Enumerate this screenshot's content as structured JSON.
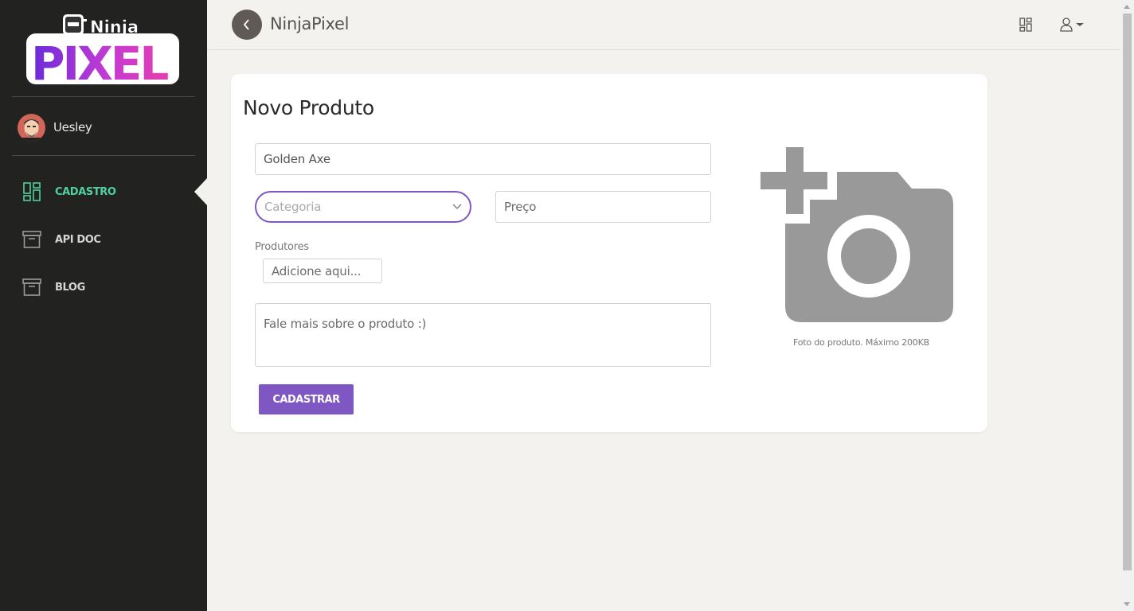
{
  "app": {
    "title": "NinjaPixel"
  },
  "logo": {
    "text_top": "Ninja",
    "text_bottom": "PIXEL"
  },
  "user": {
    "name": "Uesley"
  },
  "sidebar": {
    "items": [
      {
        "label": "CADASTRO",
        "icon": "dashboard-icon",
        "active": true
      },
      {
        "label": "API DOC",
        "icon": "archive-icon",
        "active": false
      },
      {
        "label": "BLOG",
        "icon": "archive-icon",
        "active": false
      }
    ]
  },
  "form": {
    "title": "Novo Produto",
    "name_value": "Golden Axe",
    "category_placeholder": "Categoria",
    "price_placeholder": "Preço",
    "producers_label": "Produtores",
    "producers_placeholder": "Adicione aqui...",
    "description_placeholder": "Fale mais sobre o produto :)",
    "submit_label": "CADASTRAR",
    "photo_caption": "Foto do produto. Máximo 200KB"
  },
  "colors": {
    "sidebar_bg": "#222220",
    "accent": "#7e57c2",
    "active_nav": "#4fd1a0",
    "photo_icon": "#999999"
  }
}
